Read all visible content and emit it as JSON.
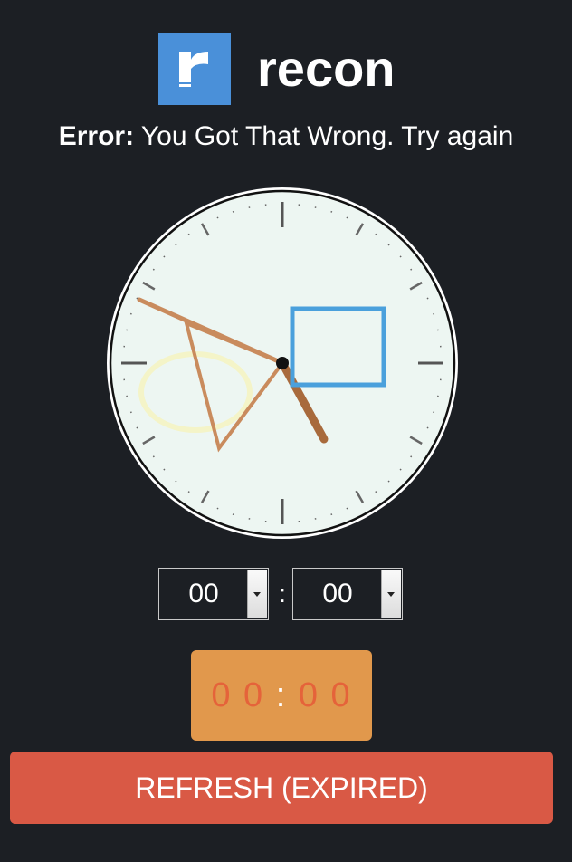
{
  "brand": {
    "name": "recon",
    "logo_icon": "recon-logo-icon",
    "logo_letter": "r",
    "logo_color": "#4a90d9"
  },
  "error": {
    "label": "Error:",
    "message": "You Got That Wrong. Try again"
  },
  "clock": {
    "icon": "analog-clock",
    "face_color": "#edf6f2",
    "decoy_shapes": [
      "triangle-outline",
      "square-outline",
      "faint-circle"
    ]
  },
  "time_input": {
    "hour_value": "00",
    "minute_value": "00",
    "separator": ":"
  },
  "countdown": {
    "minutes": "0 0",
    "separator": ":",
    "seconds": "0 0",
    "background": "#e1984c",
    "digit_color": "#e5633a"
  },
  "refresh_button": {
    "label": "REFRESH (EXPIRED)",
    "color": "#d95945"
  }
}
